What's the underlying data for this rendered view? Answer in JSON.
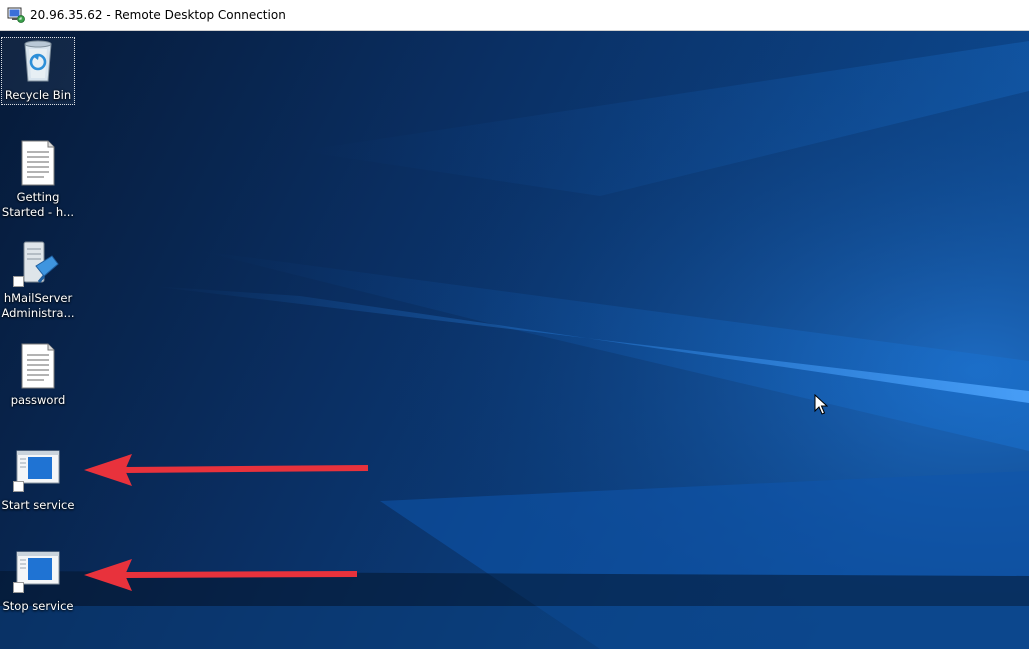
{
  "window": {
    "title": "20.96.35.62 - Remote Desktop Connection",
    "icon": "remote-desktop-icon"
  },
  "desktop": {
    "icons": [
      {
        "label": "Recycle Bin",
        "icon": "recycle-bin-icon",
        "selected": true
      },
      {
        "label": "Getting Started - h...",
        "icon": "text-document-icon"
      },
      {
        "label": "hMailServer Administra...",
        "icon": "hmailserver-icon",
        "shortcut": true
      },
      {
        "label": "password",
        "icon": "text-document-icon"
      },
      {
        "label": "Start service",
        "icon": "app-window-icon",
        "shortcut": true
      },
      {
        "label": "Stop service",
        "icon": "app-window-icon",
        "shortcut": true
      }
    ]
  },
  "colors": {
    "annotation_arrow": "#e8323c",
    "wallpaper_dark": "#061a38",
    "wallpaper_light": "#1a6fd0"
  }
}
